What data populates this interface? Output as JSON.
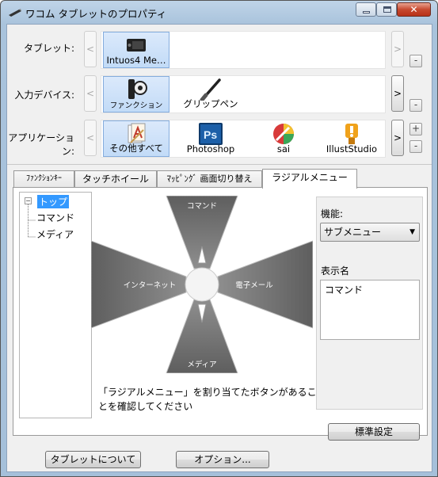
{
  "window": {
    "title": "ワコム タブレットのプロパティ",
    "close_glyph": "✕"
  },
  "tablet_row": {
    "label": "タブレット:",
    "prev": "<",
    "next": ">",
    "items": [
      {
        "label": "Intuos4 Me…",
        "icon": "tablet-icon"
      }
    ],
    "remove": "-"
  },
  "device_row": {
    "label": "入力デバイス:",
    "prev": "<",
    "next": ">",
    "items": [
      {
        "label": "ファンクション",
        "icon": "function-keys-icon"
      },
      {
        "label": "グリップペン",
        "icon": "grip-pen-icon"
      }
    ],
    "remove": "-"
  },
  "app_row": {
    "label": "アプリケーション:",
    "prev": "<",
    "next": ">",
    "items": [
      {
        "label": "その他すべて",
        "icon": "all-other-apps-icon"
      },
      {
        "label": "Photoshop",
        "icon": "photoshop-icon"
      },
      {
        "label": "sai",
        "icon": "sai-icon"
      },
      {
        "label": "IllustStudio",
        "icon": "illuststudio-icon"
      }
    ],
    "add": "+",
    "remove": "-"
  },
  "tabs": [
    "ﾌｧﾝｸｼｮﾝｷｰ",
    "タッチホイール",
    "ﾏｯﾋﾟﾝｸﾞ 画面切り替え",
    "ラジアルメニュー"
  ],
  "active_tab": "ラジアルメニュー",
  "tree": {
    "expander": "−",
    "root": "トップ",
    "children": [
      "コマンド",
      "メディア"
    ]
  },
  "radial": {
    "top": "コマンド",
    "left": "インターネット",
    "right": "電子メール",
    "bottom": "メディア"
  },
  "message": "「ラジアルメニュー」を割り当てたボタンがあることを確認してください",
  "side": {
    "function_label": "機能:",
    "function_value": "サブメニュー",
    "display_label": "表示名",
    "display_value": "コマンド"
  },
  "buttons": {
    "defaults": "標準設定",
    "about": "タブレットについて",
    "options": "オプション..."
  },
  "colors": {
    "selection": "#3399ff",
    "tile_selected": "#c2dbf7",
    "radial_segment": "#7a7a7a"
  }
}
